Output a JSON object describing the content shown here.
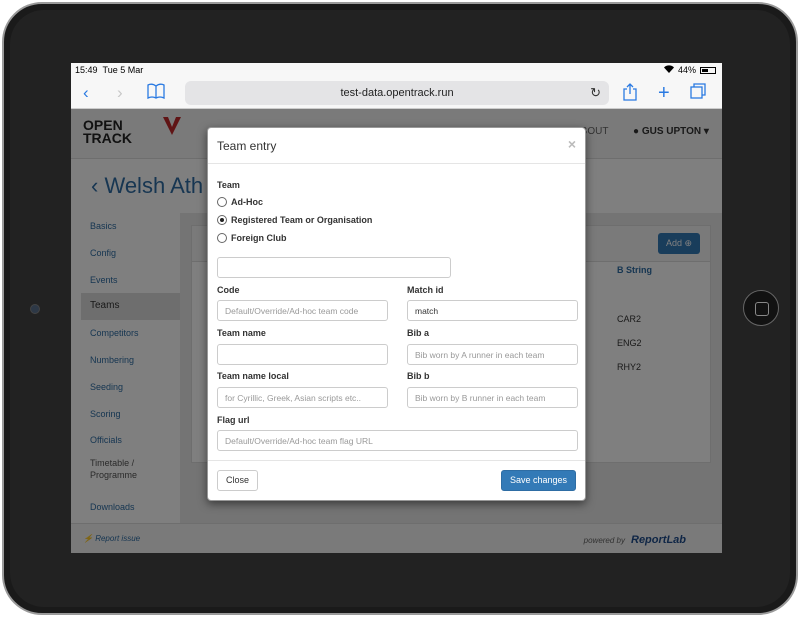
{
  "status_bar": {
    "time": "15:49",
    "date": "Tue 5 Mar",
    "battery": "44%"
  },
  "browser": {
    "url": "test-data.opentrack.run"
  },
  "site": {
    "logo_line1": "OPEN",
    "logo_line2": "TRACK",
    "nav_about": "ABOUT",
    "nav_user": "GUS UPTON",
    "page_title": "Welsh Ath"
  },
  "sidebar": {
    "items": [
      "Basics",
      "Config",
      "Events",
      "Teams",
      "Competitors",
      "Numbering",
      "Seeding",
      "Scoring",
      "Officials",
      "Timetable / Programme",
      "Downloads"
    ],
    "active": "Teams"
  },
  "panel": {
    "add_label": "Add",
    "b_string_header": "B String",
    "b_string_values": [
      "CAR2",
      "ENG2",
      "RHY2"
    ]
  },
  "footer": {
    "report_issue": "Report issue",
    "powered_by": "powered by",
    "brand": "ReportLab"
  },
  "modal": {
    "title": "Team entry",
    "close_glyph": "×",
    "team_label": "Team",
    "team_options": [
      "Ad-Hoc",
      "Registered Team or Organisation",
      "Foreign Club"
    ],
    "selected_team_option": "Registered Team or Organisation",
    "team_select_value": "",
    "code_label": "Code",
    "code_placeholder": "Default/Override/Ad-hoc team code",
    "match_id_label": "Match id",
    "match_id_value": "match",
    "team_name_label": "Team name",
    "team_name_value": "",
    "bib_a_label": "Bib a",
    "bib_a_placeholder": "Bib worn by A runner in each team",
    "team_name_local_label": "Team name local",
    "team_name_local_placeholder": "for Cyrillic, Greek, Asian scripts etc..",
    "bib_b_label": "Bib b",
    "bib_b_placeholder": "Bib worn by B runner in each team",
    "flag_url_label": "Flag url",
    "flag_url_placeholder": "Default/Override/Ad-hoc team flag URL",
    "close_button": "Close",
    "save_button": "Save changes"
  }
}
